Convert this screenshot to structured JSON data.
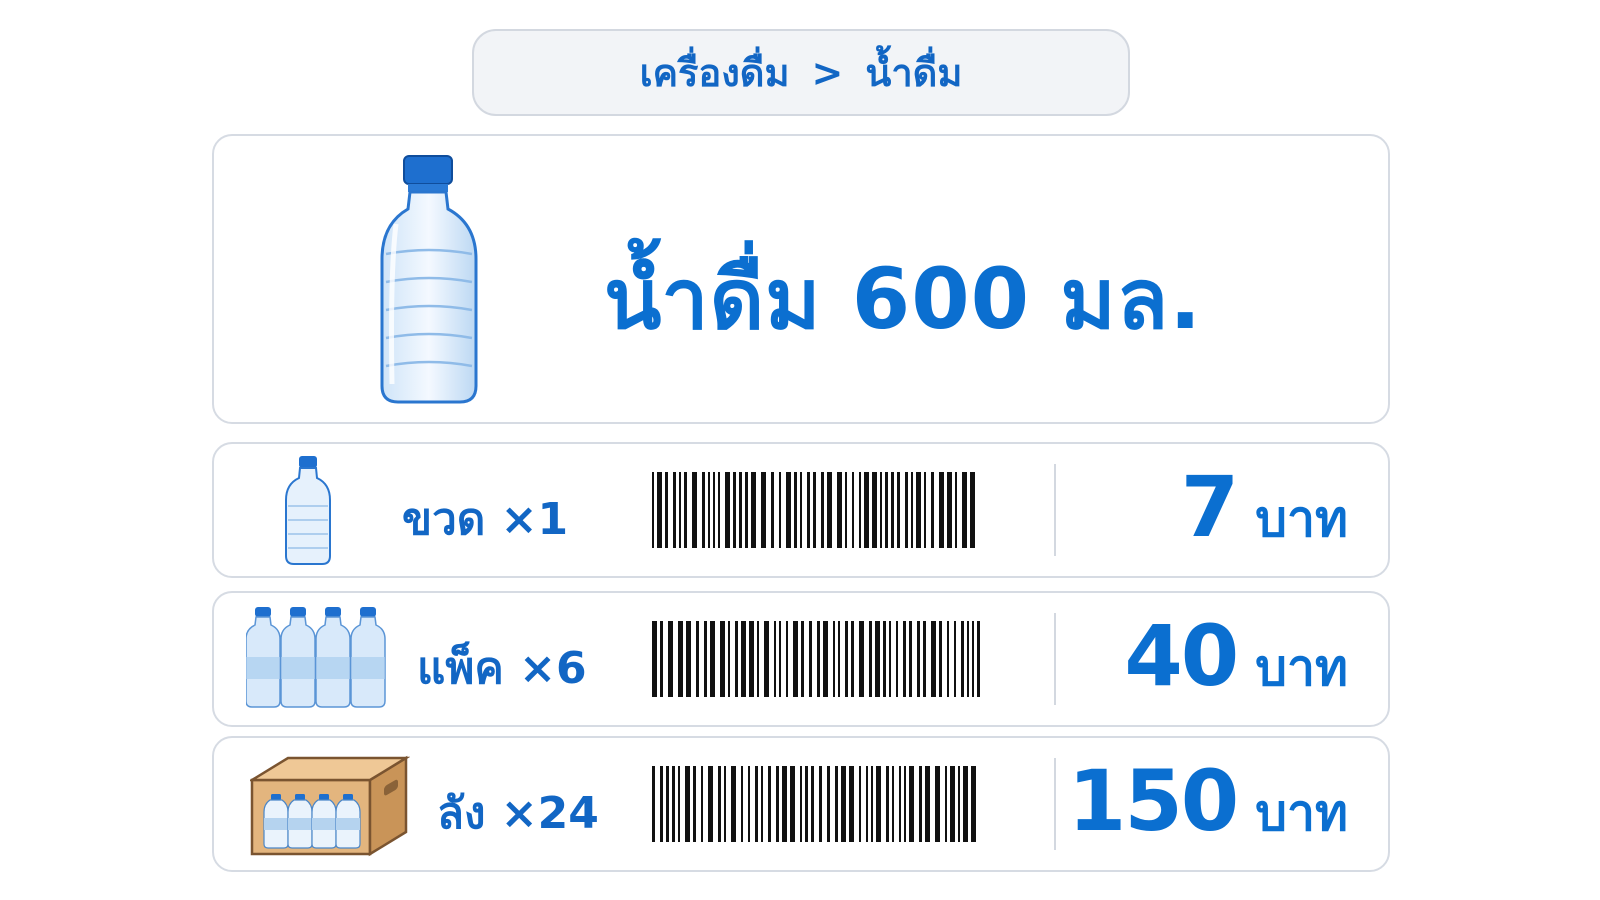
{
  "breadcrumb": {
    "category": "เครื่องดื่ม",
    "separator": ">",
    "subcategory": "น้ำดื่ม"
  },
  "product": {
    "title": "น้ำดื่ม 600 มล.",
    "icon": "water-bottle-icon"
  },
  "options": [
    {
      "label": "ขวด ×1",
      "price": "7",
      "currency": "บาท",
      "icon": "single-bottle-icon"
    },
    {
      "label": "แพ็ค ×6",
      "price": "40",
      "currency": "บาท",
      "icon": "six-pack-icon"
    },
    {
      "label": "ลัง ×24",
      "price": "150",
      "currency": "บาท",
      "icon": "case-box-icon"
    }
  ],
  "colors": {
    "accent": "#0b6fd0",
    "border": "#d6dbe3",
    "breadcrumb_bg": "#f2f4f7"
  }
}
